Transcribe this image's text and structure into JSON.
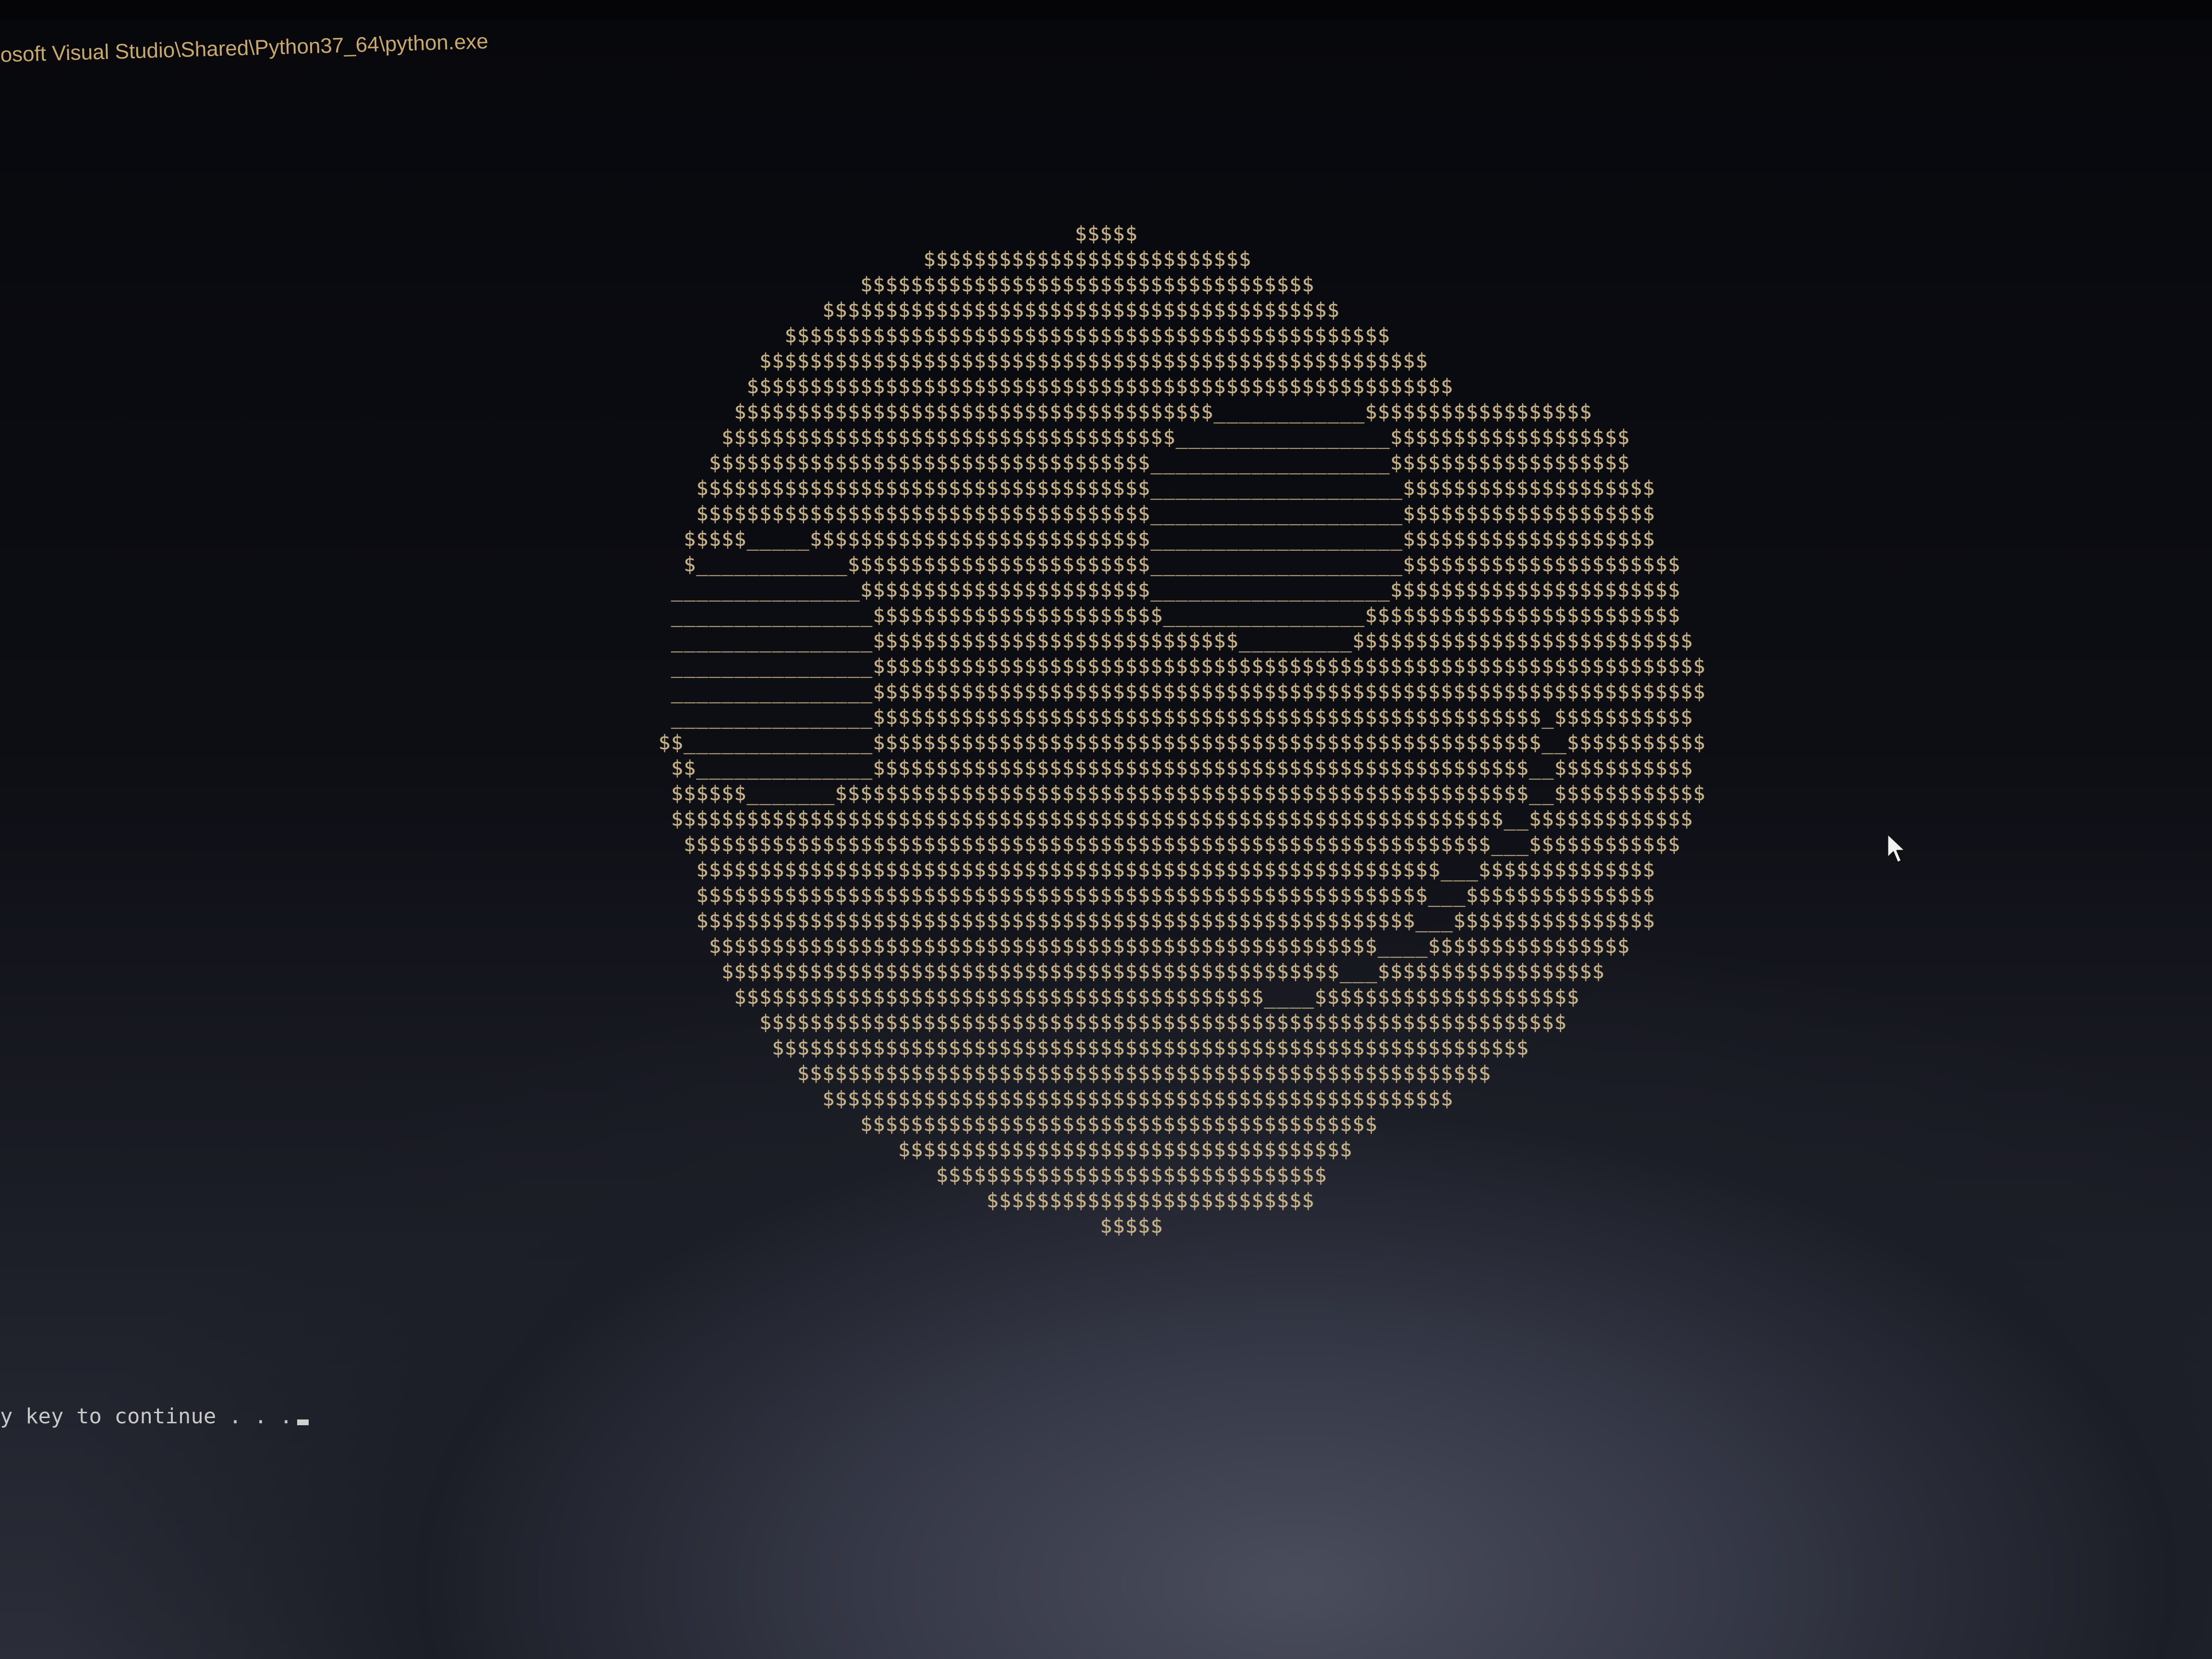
{
  "window": {
    "title": "osoft Visual Studio\\Shared\\Python37_64\\python.exe"
  },
  "console": {
    "ascii_art": "                                      $$$$$\n                          $$$$$$$$$$$$$$$$$$$$$$$$$$\n                     $$$$$$$$$$$$$$$$$$$$$$$$$$$$$$$$$$$$\n                  $$$$$$$$$$$$$$$$$$$$$$$$$$$$$$$$$$$$$$$$$\n               $$$$$$$$$$$$$$$$$$$$$$$$$$$$$$$$$$$$$$$$$$$$$$$$\n             $$$$$$$$$$$$$$$$$$$$$$$$$$$$$$$$$$$$$$$$$$$$$$$$$$$$$\n            $$$$$$$$$$$$$$$$$$$$$$$$$$$$$$$$$$$$$$$$$$$$$$$$$$$$$$$$\n           $$$$$$$$$$$$$$$$$$$$$$$$$$$$$$$$$$$$$$____________$$$$$$$$$$$$$$$$$$\n          $$$$$$$$$$$$$$$$$$$$$$$$$$$$$$$$$$$$_________________$$$$$$$$$$$$$$$$$$$\n         $$$$$$$$$$$$$$$$$$$$$$$$$$$$$$$$$$$___________________$$$$$$$$$$$$$$$$$$$\n        $$$$$$$$$$$$$$$$$$$$$$$$$$$$$$$$$$$$____________________$$$$$$$$$$$$$$$$$$$$\n        $$$$$$$$$$$$$$$$$$$$$$$$$$$$$$$$$$$$____________________$$$$$$$$$$$$$$$$$$$$\n       $$$$$_____$$$$$$$$$$$$$$$$$$$$$$$$$$$____________________$$$$$$$$$$$$$$$$$$$$\n       $____________$$$$$$$$$$$$$$$$$$$$$$$$____________________$$$$$$$$$$$$$$$$$$$$$$\n      _______________$$$$$$$$$$$$$$$$$$$$$$$___________________$$$$$$$$$$$$$$$$$$$$$$$\n      ________________$$$$$$$$$$$$$$$$$$$$$$$________________$$$$$$$$$$$$$$$$$$$$$$$$$\n      ________________$$$$$$$$$$$$$$$$$$$$$$$$$$$$$_________$$$$$$$$$$$$$$$$$$$$$$$$$$$\n      ________________$$$$$$$$$$$$$$$$$$$$$$$$$$$$$$$$$$$$$$$$$$$$$$$$$$$$$$$$$$$$$$$$$$\n      ________________$$$$$$$$$$$$$$$$$$$$$$$$$$$$$$$$$$$$$$$$$$$$$$$$$$$$$$$$$$$$$$$$$$\n      ________________$$$$$$$$$$$$$$$$$$$$$$$$$$$$$$$$$$$$$$$$$$$$$$$$$$$$$_$$$$$$$$$$$\n     $$_______________$$$$$$$$$$$$$$$$$$$$$$$$$$$$$$$$$$$$$$$$$$$$$$$$$$$$$__$$$$$$$$$$$\n      $$______________$$$$$$$$$$$$$$$$$$$$$$$$$$$$$$$$$$$$$$$$$$$$$$$$$$$$__$$$$$$$$$$$\n      $$$$$$_______$$$$$$$$$$$$$$$$$$$$$$$$$$$$$$$$$$$$$$$$$$$$$$$$$$$$$$$__$$$$$$$$$$$$\n      $$$$$$$$$$$$$$$$$$$$$$$$$$$$$$$$$$$$$$$$$$$$$$$$$$$$$$$$$$$$$$$$$$__$$$$$$$$$$$$$\n       $$$$$$$$$$$$$$$$$$$$$$$$$$$$$$$$$$$$$$$$$$$$$$$$$$$$$$$$$$$$$$$$___$$$$$$$$$$$$\n        $$$$$$$$$$$$$$$$$$$$$$$$$$$$$$$$$$$$$$$$$$$$$$$$$$$$$$$$$$$___$$$$$$$$$$$$$$\n        $$$$$$$$$$$$$$$$$$$$$$$$$$$$$$$$$$$$$$$$$$$$$$$$$$$$$$$$$$___$$$$$$$$$$$$$$$\n        $$$$$$$$$$$$$$$$$$$$$$$$$$$$$$$$$$$$$$$$$$$$$$$$$$$$$$$$$___$$$$$$$$$$$$$$$$\n         $$$$$$$$$$$$$$$$$$$$$$$$$$$$$$$$$$$$$$$$$$$$$$$$$$$$$____$$$$$$$$$$$$$$$$\n          $$$$$$$$$$$$$$$$$$$$$$$$$$$$$$$$$$$$$$$$$$$$$$$$$___$$$$$$$$$$$$$$$$$$\n           $$$$$$$$$$$$$$$$$$$$$$$$$$$$$$$$$$$$$$$$$$____$$$$$$$$$$$$$$$$$$$$$\n             $$$$$$$$$$$$$$$$$$$$$$$$$$$$$$$$$$$$$$$$$$$$$$$$$$$$$$$$$$$$$$$$\n              $$$$$$$$$$$$$$$$$$$$$$$$$$$$$$$$$$$$$$$$$$$$$$$$$$$$$$$$$$$$\n                $$$$$$$$$$$$$$$$$$$$$$$$$$$$$$$$$$$$$$$$$$$$$$$$$$$$$$$\n                  $$$$$$$$$$$$$$$$$$$$$$$$$$$$$$$$$$$$$$$$$$$$$$$$$$\n                     $$$$$$$$$$$$$$$$$$$$$$$$$$$$$$$$$$$$$$$$$\n                        $$$$$$$$$$$$$$$$$$$$$$$$$$$$$$$$$$$$\n                           $$$$$$$$$$$$$$$$$$$$$$$$$$$$$$$\n                               $$$$$$$$$$$$$$$$$$$$$$$$$$\n                                        $$$$$",
    "prompt": "y key to continue . . ."
  },
  "colors": {
    "background": "#0b0c12",
    "ascii_text": "#c9b48a",
    "title_text": "#c9a96b",
    "prompt_text": "#c8c8c8"
  },
  "icons": {
    "pointer": "mouse-pointer-icon"
  }
}
